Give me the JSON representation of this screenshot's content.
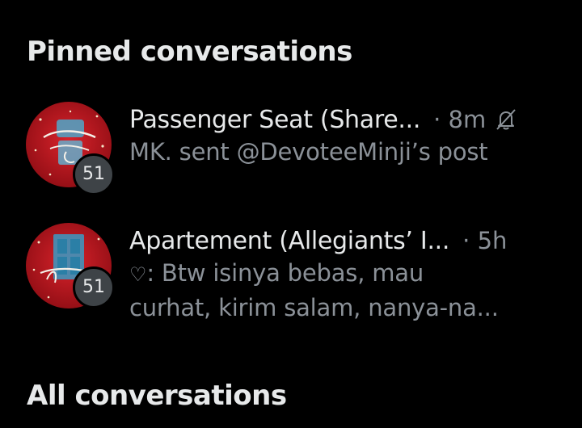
{
  "sections": {
    "pinned_title": "Pinned conversations",
    "all_title": "All conversations"
  },
  "conversations": [
    {
      "name": "Passenger Seat (Share...",
      "time": "· 8m",
      "muted": true,
      "preview_line1": "MK. sent @DevoteeMinji’s post",
      "preview_line2": "",
      "unread_count": "51",
      "avatar_text": "Passenger Seat",
      "avatar_color": "#b3141c"
    },
    {
      "name": "Apartement (Allegiants’ I...",
      "time": "· 5h",
      "muted": false,
      "preview_icon": "♡",
      "preview_line1": ": Btw isinya bebas, mau",
      "preview_line2": "curhat, kirim salam, nanya-na...",
      "unread_count": "51",
      "avatar_text": "Apartment",
      "avatar_color": "#b3141c"
    }
  ],
  "colors": {
    "background": "#000000",
    "primary_text": "#e7e9ea",
    "secondary_text": "#8b9198",
    "badge_bg": "#3e4347"
  },
  "icons": {
    "mute": "bell-slash-icon",
    "heart": "heart-icon"
  }
}
